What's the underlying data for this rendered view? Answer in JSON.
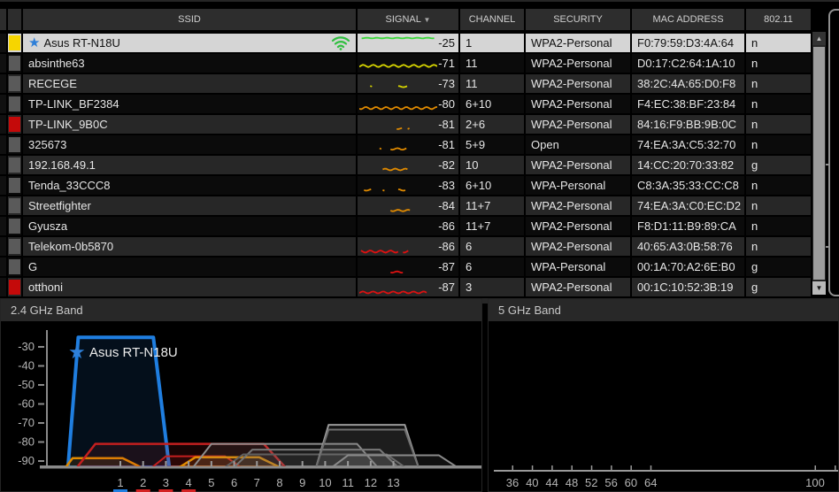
{
  "icons": {
    "sort_desc": "▼",
    "star": "★",
    "arrow_up": "▲",
    "arrow_down": "▼"
  },
  "table": {
    "header": {
      "ssid": "SSID",
      "signal": "SIGNAL",
      "channel": "CHANNEL",
      "security": "SECURITY",
      "mac": "MAC ADDRESS",
      "standard": "802.11"
    },
    "sorted_by": "SIGNAL",
    "rows": [
      {
        "ssid": "Asus RT-N18U",
        "signal": -25,
        "channel": "1",
        "security": "WPA2-Personal",
        "mac": "F0:79:59:D3:4A:64",
        "standard": "n",
        "swatch": "#f6d500",
        "selected": true,
        "starred": true,
        "wifi": true,
        "spark_color": "#39d839",
        "spark_amp": 0.4,
        "spark_segments": [
          [
            3,
            97
          ]
        ]
      },
      {
        "ssid": "absinthe63",
        "signal": -71,
        "channel": "11",
        "security": "WPA2-Personal",
        "mac": "D0:17:C2:64:1A:10",
        "standard": "n",
        "swatch": "#5a5a5a",
        "spark_color": "#d6d400",
        "spark_amp": 1.3,
        "spark_segments": [
          [
            0,
            100
          ]
        ]
      },
      {
        "ssid": "RECEGE",
        "signal": -73,
        "channel": "11",
        "security": "WPA2-Personal",
        "mac": "38:2C:4A:65:D0:F8",
        "standard": "n",
        "swatch": "#5a5a5a",
        "spark_color": "#d6d400",
        "spark_amp": 0.7,
        "spark_segments": [
          [
            14,
            18
          ],
          [
            50,
            62
          ]
        ]
      },
      {
        "ssid": "TP-LINK_BF2384",
        "signal": -80,
        "channel": "6+10",
        "security": "WPA2-Personal",
        "mac": "F4:EC:38:BF:23:84",
        "standard": "n",
        "swatch": "#5a5a5a",
        "spark_color": "#e08a00",
        "spark_amp": 1.3,
        "spark_segments": [
          [
            0,
            100
          ]
        ]
      },
      {
        "ssid": "TP-LINK_9B0C",
        "signal": -81,
        "channel": "2+6",
        "security": "WPA2-Personal",
        "mac": "84:16:F9:BB:9B:0C",
        "standard": "n",
        "swatch": "#c40a0a",
        "spark_color": "#e08a00",
        "spark_amp": 0.7,
        "spark_segments": [
          [
            48,
            56
          ],
          [
            62,
            66
          ]
        ]
      },
      {
        "ssid": "325673",
        "signal": -81,
        "channel": "5+9",
        "security": "Open",
        "mac": "74:EA:3A:C5:32:70",
        "standard": "n",
        "swatch": "#5a5a5a",
        "spark_color": "#e08a00",
        "spark_amp": 0.9,
        "spark_segments": [
          [
            26,
            30
          ],
          [
            40,
            62
          ]
        ]
      },
      {
        "ssid": "192.168.49.1",
        "signal": -82,
        "channel": "10",
        "security": "WPA2-Personal",
        "mac": "14:CC:20:70:33:82",
        "standard": "g",
        "swatch": "#5a5a5a",
        "spark_color": "#e08a00",
        "spark_amp": 1.0,
        "spark_segments": [
          [
            30,
            62
          ]
        ]
      },
      {
        "ssid": "Tenda_33CCC8",
        "signal": -83,
        "channel": "6+10",
        "security": "WPA-Personal",
        "mac": "C8:3A:35:33:CC:C8",
        "standard": "n",
        "swatch": "#5a5a5a",
        "spark_color": "#e08a00",
        "spark_amp": 0.8,
        "spark_segments": [
          [
            6,
            16
          ],
          [
            30,
            34
          ],
          [
            50,
            60
          ]
        ]
      },
      {
        "ssid": "Streetfighter",
        "signal": -84,
        "channel": "11+7",
        "security": "WPA2-Personal",
        "mac": "74:EA:3A:C0:EC:D2",
        "standard": "n",
        "swatch": "#5a5a5a",
        "spark_color": "#e08a00",
        "spark_amp": 0.9,
        "spark_segments": [
          [
            40,
            66
          ]
        ]
      },
      {
        "ssid": "Gyusza",
        "signal": -86,
        "channel": "11+7",
        "security": "WPA2-Personal",
        "mac": "F8:D1:11:B9:89:CA",
        "standard": "n",
        "swatch": "#5a5a5a",
        "spark_color": "#dd1111",
        "spark_amp": 0.8,
        "spark_segments": []
      },
      {
        "ssid": "Telekom-0b5870",
        "signal": -86,
        "channel": "6",
        "security": "WPA2-Personal",
        "mac": "40:65:A3:0B:58:76",
        "standard": "n",
        "swatch": "#5a5a5a",
        "spark_color": "#dd1111",
        "spark_amp": 1.2,
        "spark_segments": [
          [
            2,
            50
          ],
          [
            56,
            64
          ]
        ]
      },
      {
        "ssid": "G",
        "signal": -87,
        "channel": "6",
        "security": "WPA-Personal",
        "mac": "00:1A:70:A2:6E:B0",
        "standard": "g",
        "swatch": "#5a5a5a",
        "spark_color": "#dd1111",
        "spark_amp": 0.8,
        "spark_segments": [
          [
            40,
            56
          ]
        ]
      },
      {
        "ssid": "otthoni",
        "signal": -87,
        "channel": "3",
        "security": "WPA2-Personal",
        "mac": "00:1C:10:52:3B:19",
        "standard": "g",
        "swatch": "#c40a0a",
        "spark_color": "#dd1111",
        "spark_amp": 1.1,
        "spark_segments": [
          [
            0,
            88
          ]
        ]
      }
    ],
    "partial_row": {
      "swatch": "#5a5a5a"
    }
  },
  "panels": {
    "band24_title": "2.4 GHz Band",
    "band5_title": "5 GHz Band"
  },
  "chart_data": [
    {
      "type": "area",
      "title": "2.4 GHz Band",
      "xlabel": "channel",
      "ylabel": "dBm",
      "y_ticks": [
        -30,
        -40,
        -50,
        -60,
        -70,
        -80,
        -90
      ],
      "x_ticks": [
        1,
        2,
        3,
        4,
        5,
        6,
        7,
        8,
        9,
        10,
        11,
        12,
        13
      ],
      "ylim": [
        -93,
        -24
      ],
      "grid": false,
      "legend": "none",
      "annotation": {
        "text": "Asus RT-N18U",
        "star": true,
        "star_color": "#2e7fd8",
        "text_color": "#ececec"
      },
      "marked_channels": [
        {
          "channel": 1,
          "color": "#1f7ee0"
        },
        {
          "channel": 2,
          "color": "#d42222"
        },
        {
          "channel": 3,
          "color": "#d42222"
        },
        {
          "channel": 4,
          "color": "#d42222"
        }
      ],
      "series": [
        {
          "name": "Asus RT-N18U",
          "color": "#1f7ee0",
          "stroke": 4,
          "peak_dbm": -25,
          "base_ch": [
            -1.3,
            3.15
          ],
          "top_ch": [
            -0.85,
            2.45
          ]
        },
        {
          "name": "",
          "color": "#e08a00",
          "stroke": 2.5,
          "peak_dbm": -88.5,
          "base_ch": [
            -1.4,
            1.9
          ],
          "top_ch": [
            -1.1,
            1.1
          ]
        },
        {
          "name": "",
          "color": "#c41f1f",
          "stroke": 2.5,
          "peak_dbm": -81,
          "base_ch": [
            -0.9,
            8.25
          ],
          "top_ch": [
            -0.1,
            7.3
          ]
        },
        {
          "name": "",
          "color": "#c41f1f",
          "stroke": 2,
          "peak_dbm": -87.5,
          "base_ch": [
            2.4,
            6.3
          ],
          "top_ch": [
            3.0,
            5.6
          ]
        },
        {
          "name": "",
          "color": "#e08a00",
          "stroke": 2.5,
          "peak_dbm": -88,
          "base_ch": [
            3.6,
            8.0
          ],
          "top_ch": [
            4.3,
            7.1
          ]
        },
        {
          "name": "",
          "color": "#8d8d8d",
          "stroke": 2,
          "peak_dbm": -81,
          "base_ch": [
            4.2,
            12.3
          ],
          "top_ch": [
            5.0,
            11.4
          ]
        },
        {
          "name": "",
          "color": "#777777",
          "stroke": 2,
          "peak_dbm": -84,
          "base_ch": [
            6.0,
            13.2
          ],
          "top_ch": [
            6.8,
            12.4
          ]
        },
        {
          "name": "",
          "color": "#5f5f5f",
          "stroke": 2,
          "peak_dbm": -86.5,
          "base_ch": [
            5.6,
            13.5
          ],
          "top_ch": [
            6.4,
            12.7
          ]
        },
        {
          "name": "",
          "color": "#9a9a9a",
          "stroke": 2,
          "peak_dbm": -71,
          "base_ch": [
            9.6,
            14.1
          ],
          "top_ch": [
            10.15,
            13.5
          ]
        },
        {
          "name": "",
          "color": "#6e6e6e",
          "stroke": 2,
          "peak_dbm": -73.5,
          "base_ch": [
            9.6,
            14.1
          ],
          "top_ch": [
            10.15,
            13.5
          ]
        },
        {
          "name": "",
          "color": "#8a8a8a",
          "stroke": 2,
          "peak_dbm": -87,
          "base_ch": [
            10.3,
            15.8
          ],
          "top_ch": [
            11.0,
            15.0
          ]
        }
      ]
    },
    {
      "type": "area",
      "title": "5 GHz Band",
      "xlabel": "channel",
      "x_ticks": [
        36,
        40,
        44,
        48,
        52,
        56,
        60,
        64,
        100
      ],
      "grid": false,
      "series": []
    }
  ]
}
